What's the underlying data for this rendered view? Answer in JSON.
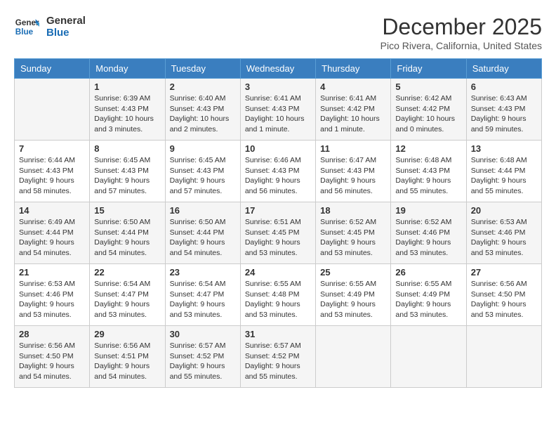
{
  "header": {
    "logo_line1": "General",
    "logo_line2": "Blue",
    "month_title": "December 2025",
    "subtitle": "Pico Rivera, California, United States"
  },
  "days_of_week": [
    "Sunday",
    "Monday",
    "Tuesday",
    "Wednesday",
    "Thursday",
    "Friday",
    "Saturday"
  ],
  "weeks": [
    [
      {
        "day": "",
        "content": ""
      },
      {
        "day": "1",
        "content": "Sunrise: 6:39 AM\nSunset: 4:43 PM\nDaylight: 10 hours\nand 3 minutes."
      },
      {
        "day": "2",
        "content": "Sunrise: 6:40 AM\nSunset: 4:43 PM\nDaylight: 10 hours\nand 2 minutes."
      },
      {
        "day": "3",
        "content": "Sunrise: 6:41 AM\nSunset: 4:43 PM\nDaylight: 10 hours\nand 1 minute."
      },
      {
        "day": "4",
        "content": "Sunrise: 6:41 AM\nSunset: 4:42 PM\nDaylight: 10 hours\nand 1 minute."
      },
      {
        "day": "5",
        "content": "Sunrise: 6:42 AM\nSunset: 4:42 PM\nDaylight: 10 hours\nand 0 minutes."
      },
      {
        "day": "6",
        "content": "Sunrise: 6:43 AM\nSunset: 4:43 PM\nDaylight: 9 hours\nand 59 minutes."
      }
    ],
    [
      {
        "day": "7",
        "content": "Sunrise: 6:44 AM\nSunset: 4:43 PM\nDaylight: 9 hours\nand 58 minutes."
      },
      {
        "day": "8",
        "content": "Sunrise: 6:45 AM\nSunset: 4:43 PM\nDaylight: 9 hours\nand 57 minutes."
      },
      {
        "day": "9",
        "content": "Sunrise: 6:45 AM\nSunset: 4:43 PM\nDaylight: 9 hours\nand 57 minutes."
      },
      {
        "day": "10",
        "content": "Sunrise: 6:46 AM\nSunset: 4:43 PM\nDaylight: 9 hours\nand 56 minutes."
      },
      {
        "day": "11",
        "content": "Sunrise: 6:47 AM\nSunset: 4:43 PM\nDaylight: 9 hours\nand 56 minutes."
      },
      {
        "day": "12",
        "content": "Sunrise: 6:48 AM\nSunset: 4:43 PM\nDaylight: 9 hours\nand 55 minutes."
      },
      {
        "day": "13",
        "content": "Sunrise: 6:48 AM\nSunset: 4:44 PM\nDaylight: 9 hours\nand 55 minutes."
      }
    ],
    [
      {
        "day": "14",
        "content": "Sunrise: 6:49 AM\nSunset: 4:44 PM\nDaylight: 9 hours\nand 54 minutes."
      },
      {
        "day": "15",
        "content": "Sunrise: 6:50 AM\nSunset: 4:44 PM\nDaylight: 9 hours\nand 54 minutes."
      },
      {
        "day": "16",
        "content": "Sunrise: 6:50 AM\nSunset: 4:44 PM\nDaylight: 9 hours\nand 54 minutes."
      },
      {
        "day": "17",
        "content": "Sunrise: 6:51 AM\nSunset: 4:45 PM\nDaylight: 9 hours\nand 53 minutes."
      },
      {
        "day": "18",
        "content": "Sunrise: 6:52 AM\nSunset: 4:45 PM\nDaylight: 9 hours\nand 53 minutes."
      },
      {
        "day": "19",
        "content": "Sunrise: 6:52 AM\nSunset: 4:46 PM\nDaylight: 9 hours\nand 53 minutes."
      },
      {
        "day": "20",
        "content": "Sunrise: 6:53 AM\nSunset: 4:46 PM\nDaylight: 9 hours\nand 53 minutes."
      }
    ],
    [
      {
        "day": "21",
        "content": "Sunrise: 6:53 AM\nSunset: 4:46 PM\nDaylight: 9 hours\nand 53 minutes."
      },
      {
        "day": "22",
        "content": "Sunrise: 6:54 AM\nSunset: 4:47 PM\nDaylight: 9 hours\nand 53 minutes."
      },
      {
        "day": "23",
        "content": "Sunrise: 6:54 AM\nSunset: 4:47 PM\nDaylight: 9 hours\nand 53 minutes."
      },
      {
        "day": "24",
        "content": "Sunrise: 6:55 AM\nSunset: 4:48 PM\nDaylight: 9 hours\nand 53 minutes."
      },
      {
        "day": "25",
        "content": "Sunrise: 6:55 AM\nSunset: 4:49 PM\nDaylight: 9 hours\nand 53 minutes."
      },
      {
        "day": "26",
        "content": "Sunrise: 6:55 AM\nSunset: 4:49 PM\nDaylight: 9 hours\nand 53 minutes."
      },
      {
        "day": "27",
        "content": "Sunrise: 6:56 AM\nSunset: 4:50 PM\nDaylight: 9 hours\nand 53 minutes."
      }
    ],
    [
      {
        "day": "28",
        "content": "Sunrise: 6:56 AM\nSunset: 4:50 PM\nDaylight: 9 hours\nand 54 minutes."
      },
      {
        "day": "29",
        "content": "Sunrise: 6:56 AM\nSunset: 4:51 PM\nDaylight: 9 hours\nand 54 minutes."
      },
      {
        "day": "30",
        "content": "Sunrise: 6:57 AM\nSunset: 4:52 PM\nDaylight: 9 hours\nand 55 minutes."
      },
      {
        "day": "31",
        "content": "Sunrise: 6:57 AM\nSunset: 4:52 PM\nDaylight: 9 hours\nand 55 minutes."
      },
      {
        "day": "",
        "content": ""
      },
      {
        "day": "",
        "content": ""
      },
      {
        "day": "",
        "content": ""
      }
    ]
  ]
}
